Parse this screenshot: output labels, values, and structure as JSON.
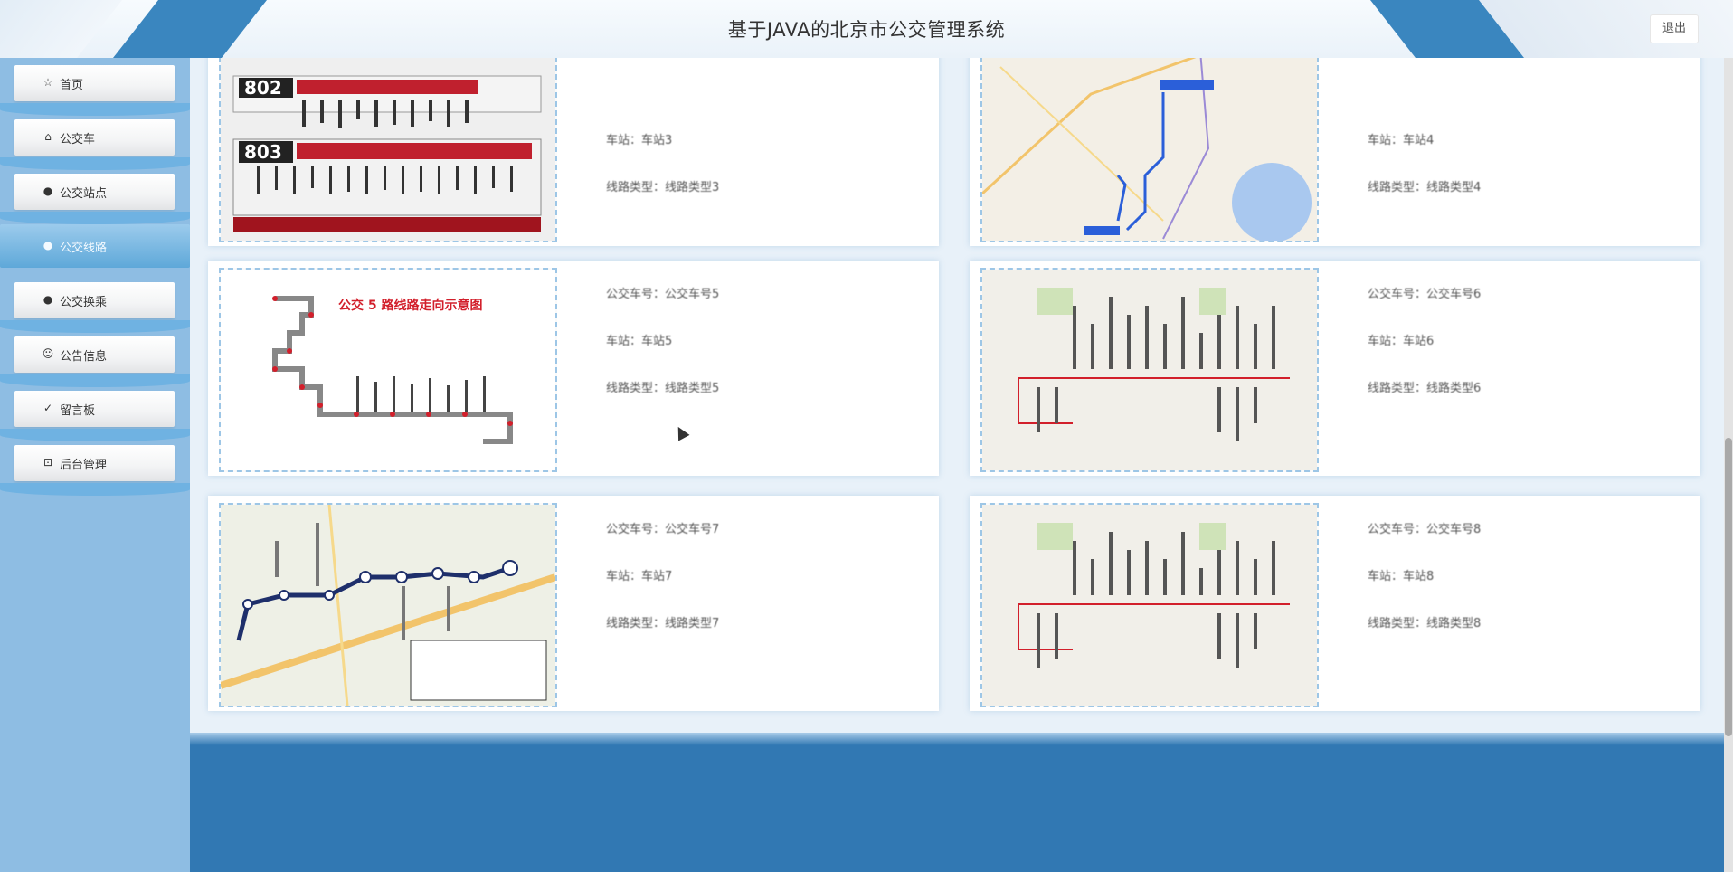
{
  "header": {
    "title": "基于JAVA的北京市公交管理系统",
    "logout_label": "退出"
  },
  "sidebar": {
    "items": [
      {
        "label": "首页",
        "icon": "home-icon",
        "glyph": "☆"
      },
      {
        "label": "公交车",
        "icon": "bag-icon",
        "glyph": "🛍"
      },
      {
        "label": "公交站点",
        "icon": "info-icon",
        "glyph": "●"
      },
      {
        "label": "公交线路",
        "icon": "circle-icon",
        "glyph": "●",
        "active": true
      },
      {
        "label": "公交换乘",
        "icon": "info-icon",
        "glyph": "●"
      },
      {
        "label": "公告信息",
        "icon": "smile-icon",
        "glyph": "☺"
      },
      {
        "label": "留言板",
        "icon": "check-circle-icon",
        "glyph": "✓"
      },
      {
        "label": "后台管理",
        "icon": "gift-icon",
        "glyph": "⊡"
      }
    ]
  },
  "cards": [
    {
      "bus_no": "",
      "station": "车站：车站3",
      "type": "线路类型：线路类型3",
      "image": "bus-route-board-photo"
    },
    {
      "bus_no": "",
      "station": "车站：车站4",
      "type": "线路类型：线路类型4",
      "image": "route-map"
    },
    {
      "bus_no": "公交车号：公交车号5",
      "station": "车站：车站5",
      "type": "线路类型：线路类型5",
      "image": "route-schematic"
    },
    {
      "bus_no": "公交车号：公交车号6",
      "station": "车站：车站6",
      "type": "线路类型：线路类型6",
      "image": "route-map-red"
    },
    {
      "bus_no": "公交车号：公交车号7",
      "station": "车站：车站7",
      "type": "线路类型：线路类型7",
      "image": "route-map-stops"
    },
    {
      "bus_no": "公交车号：公交车号8",
      "station": "车站：车站8",
      "type": "线路类型：线路类型8",
      "image": "route-map-red"
    }
  ],
  "thumb_texts": {
    "route5_title": "公交 5 路线路走向示意图",
    "board_top": "802",
    "board_bottom": "803"
  },
  "colors": {
    "brand_blue": "#3a86bf",
    "sidebar_bg": "#8ebde3",
    "active_nav": "#5ea8d9",
    "footer": "#3178b3"
  }
}
